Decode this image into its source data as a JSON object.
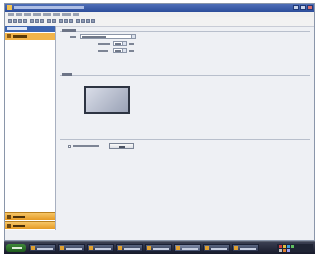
{
  "colors": {
    "titlebar": "#3d64b0",
    "panel_header": "#3d64b0",
    "selected_item": "#f2b44a",
    "side_button": "#f0aa3a",
    "taskbar": "#1e2232"
  },
  "window": {
    "title": "",
    "controls": [
      "minimize",
      "maximize",
      "close"
    ]
  },
  "menubar": {
    "items": [
      "",
      "",
      "",
      "",
      "",
      "",
      "",
      ""
    ]
  },
  "toolbar": {
    "icons": [
      "new-icon",
      "open-icon",
      "save-icon",
      "print-icon",
      "cut-icon",
      "copy-icon",
      "paste-icon",
      "undo-icon",
      "redo-icon",
      "find-icon",
      "zoom-icon",
      "help-icon"
    ]
  },
  "sidebar": {
    "header": "",
    "selected_item": "",
    "bottom_buttons": [
      "",
      ""
    ]
  },
  "content": {
    "sections": {
      "page_size": "",
      "preview": ""
    },
    "fields": {
      "type_value": "",
      "width_value": "",
      "height_value": ""
    },
    "checkbox_label": "",
    "apply_button": ""
  },
  "taskbar": {
    "start_label": "",
    "tasks": [
      "",
      "",
      "",
      "",
      "",
      "",
      "",
      ""
    ],
    "clock": ""
  }
}
